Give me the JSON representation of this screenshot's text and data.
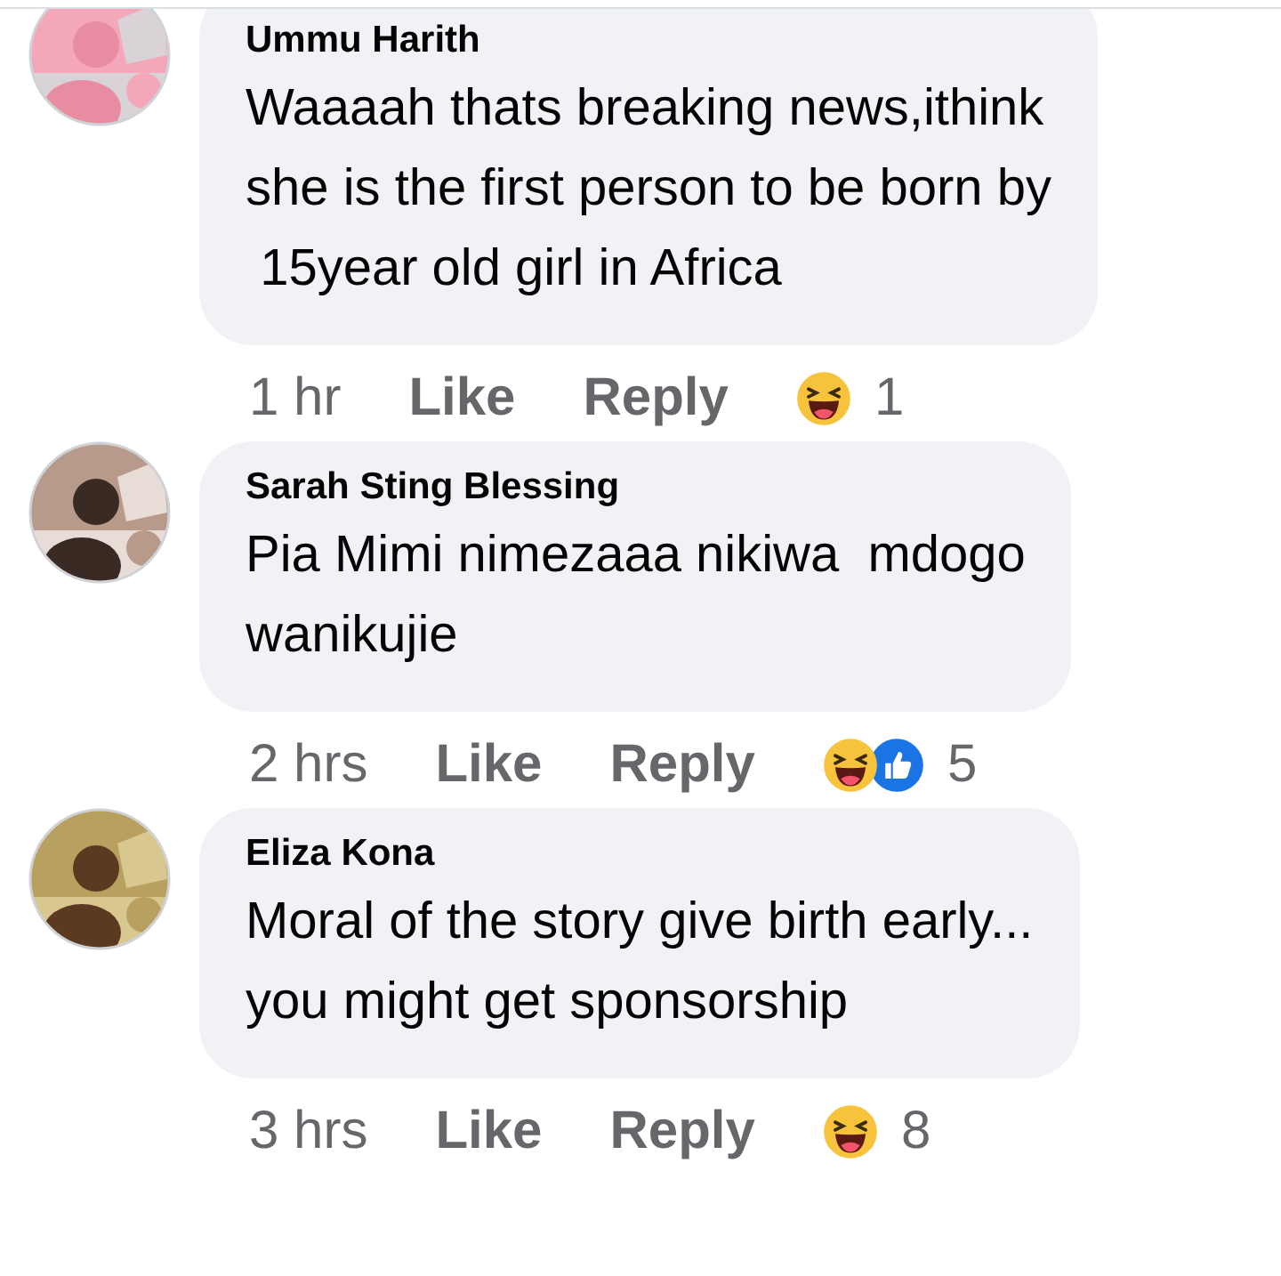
{
  "comments": [
    {
      "author": "Ummu Harith",
      "avatar": {
        "kind": "picture"
      },
      "text": "Waaaah thats breaking news,ithink\nshe is the first person to be born by\n 15year old girl in Africa",
      "time": "1 hr",
      "like": "Like",
      "reply": "Reply",
      "reactions": [
        {
          "kind": "haha"
        }
      ],
      "reaction_count": "1"
    },
    {
      "author": "Sarah Sting Blessing",
      "avatar": {
        "kind": "picture"
      },
      "text": "Pia Mimi nimezaaa nikiwa  mdogo\nwanikujie",
      "time": "2 hrs",
      "like": "Like",
      "reply": "Reply",
      "reactions": [
        {
          "kind": "haha"
        },
        {
          "kind": "like"
        }
      ],
      "reaction_count": "5"
    },
    {
      "author": "Eliza Kona",
      "avatar": {
        "kind": "picture"
      },
      "text": "Moral of the story give birth early...\nyou might get sponsorship",
      "time": "3 hrs",
      "like": "Like",
      "reply": "Reply",
      "reactions": [
        {
          "kind": "haha"
        }
      ],
      "reaction_count": "8"
    }
  ]
}
